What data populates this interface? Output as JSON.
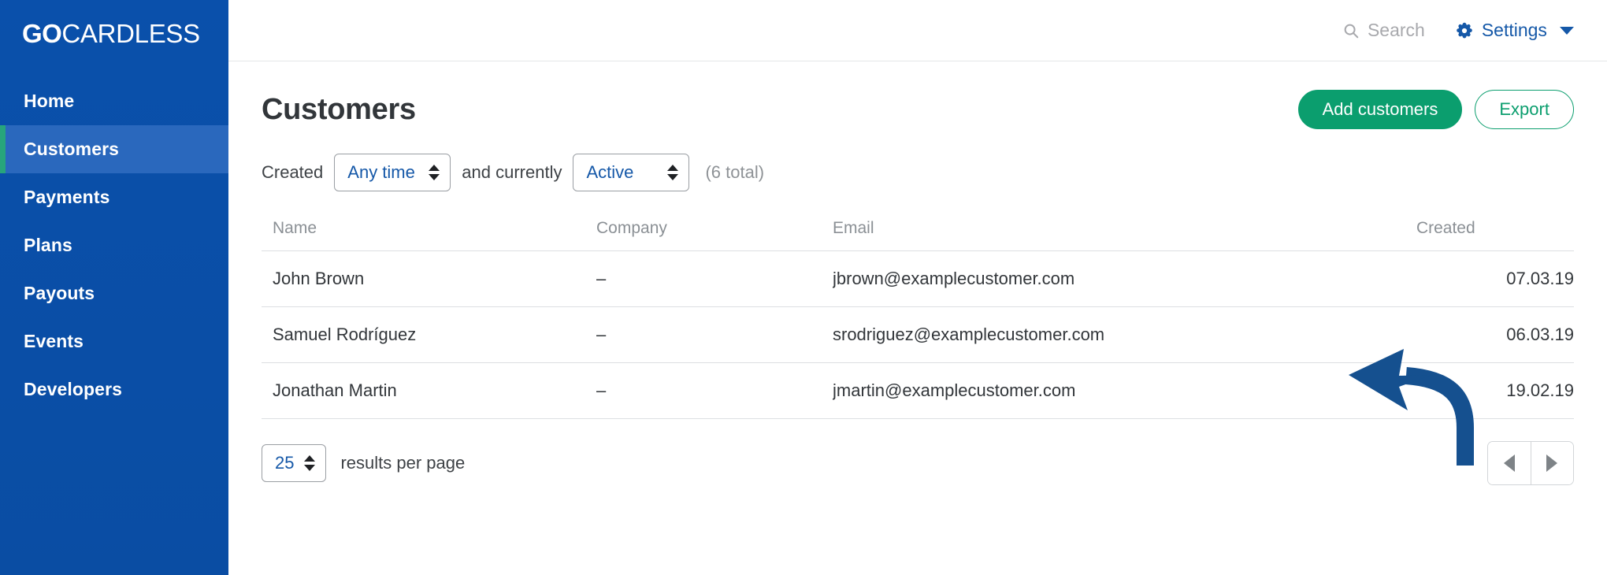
{
  "brand": {
    "logo_bold": "GO",
    "logo_light": "CARDLESS",
    "sidebar_bg": "#0a4fa8",
    "active_bg": "#2a68bd",
    "active_accent": "#27a57c"
  },
  "sidebar": {
    "items": [
      {
        "label": "Home",
        "active": false
      },
      {
        "label": "Customers",
        "active": true
      },
      {
        "label": "Payments",
        "active": false
      },
      {
        "label": "Plans",
        "active": false
      },
      {
        "label": "Payouts",
        "active": false
      },
      {
        "label": "Events",
        "active": false
      },
      {
        "label": "Developers",
        "active": false
      }
    ]
  },
  "topbar": {
    "search_label": "Search",
    "search_icon": "search-icon",
    "settings_label": "Settings",
    "settings_icon": "gear-icon",
    "settings_caret": "chevron-down-icon",
    "settings_color": "#1558a8",
    "search_color": "#a8a9ad"
  },
  "page": {
    "title": "Customers",
    "primary_button": "Add customers",
    "secondary_button": "Export",
    "primary_color": "#0b9e6e"
  },
  "filters": {
    "created_label": "Created",
    "created_value": "Any time",
    "connector_label": "and currently",
    "status_value": "Active",
    "total_label": "(6 total)"
  },
  "table": {
    "columns": [
      "Name",
      "Company",
      "Email",
      "Created"
    ],
    "rows": [
      {
        "name": "John Brown",
        "company": "–",
        "email": "jbrown@examplecustomer.com",
        "created": "07.03.19"
      },
      {
        "name": "Samuel Rodríguez",
        "company": "–",
        "email": "srodriguez@examplecustomer.com",
        "created": "06.03.19"
      },
      {
        "name": "Jonathan Martin",
        "company": "–",
        "email": "jmartin@examplecustomer.com",
        "created": "19.02.19"
      }
    ]
  },
  "pagination": {
    "per_page_value": "25",
    "per_page_label": "results per page",
    "prev_icon": "triangle-left-icon",
    "next_icon": "triangle-right-icon"
  },
  "annotation": {
    "arrow_color": "#15508f",
    "points_at": "jbrown@examplecustomer.com"
  }
}
